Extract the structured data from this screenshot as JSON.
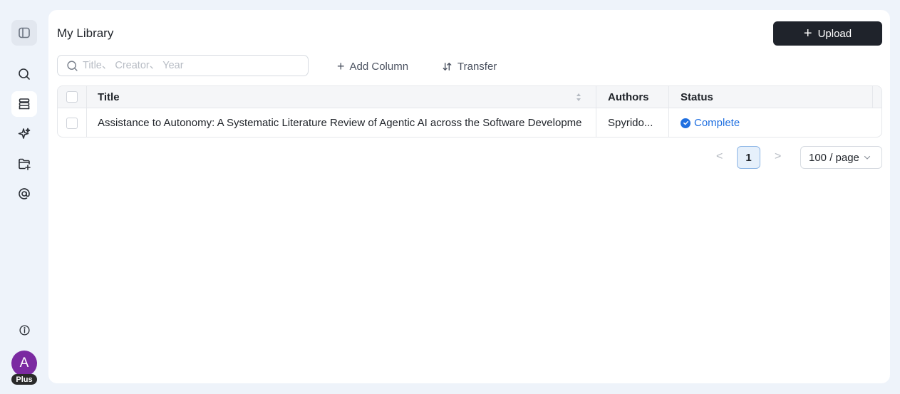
{
  "sidebar": {
    "items": [
      {
        "name": "toggle-sidebar",
        "icon": "sidebar-toggle-icon"
      },
      {
        "name": "search",
        "icon": "search-icon"
      },
      {
        "name": "library",
        "icon": "database-icon",
        "active": true
      },
      {
        "name": "ai",
        "icon": "sparkle-icon"
      },
      {
        "name": "folder",
        "icon": "folder-add-icon"
      },
      {
        "name": "mention",
        "icon": "at-icon"
      }
    ],
    "info_icon": "info-icon",
    "avatar_letter": "A",
    "plan_badge": "Plus",
    "avatar_color": "#7b2aa1"
  },
  "header": {
    "title": "My Library",
    "upload_label": "Upload"
  },
  "toolbar": {
    "search_placeholder": "Title、 Creator、 Year",
    "add_column_label": "Add Column",
    "transfer_label": "Transfer"
  },
  "table": {
    "columns": [
      "Title",
      "Authors",
      "Status"
    ],
    "rows": [
      {
        "title": "Assistance to Autonomy: A Systematic Literature Review of Agentic AI across the Software Developme",
        "authors": "Spyrido...",
        "status": "Complete"
      }
    ]
  },
  "pagination": {
    "prev": "<",
    "current_page": "1",
    "next": ">",
    "page_size": "100 / page"
  },
  "colors": {
    "accent": "#1f6fe0",
    "upload_bg": "#1f232b",
    "background": "#eef3fa"
  }
}
